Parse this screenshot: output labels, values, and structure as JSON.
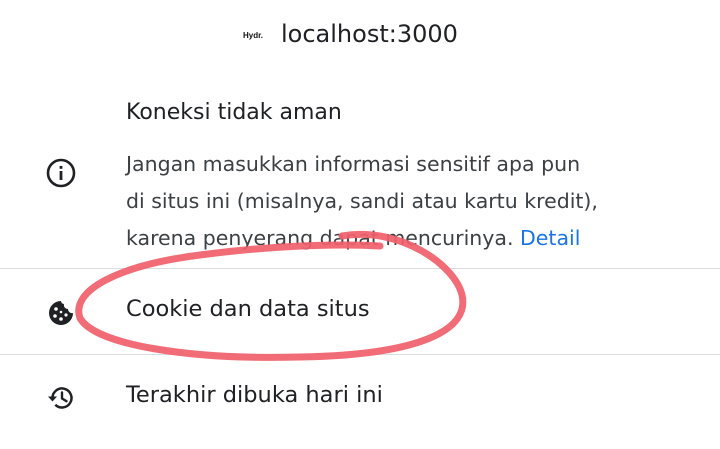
{
  "header": {
    "favicon_text": "Hydr.",
    "host": "localhost:3000"
  },
  "connection": {
    "icon": "info-icon",
    "title": "Koneksi tidak aman",
    "description_lines": [
      "Jangan masukkan informasi sensitif apa pun",
      "di situs ini (misalnya, sandi atau kartu kredit),",
      "karena penyerang dapat mencurinya."
    ],
    "detail_link": "Detail"
  },
  "menu": [
    {
      "icon": "cookie-icon",
      "label": "Cookie dan data situs"
    },
    {
      "icon": "history-icon",
      "label": "Terakhir dibuka hari ini"
    }
  ],
  "colors": {
    "link": "#1a73e8",
    "annotation": "#f0606a",
    "divider": "#dadce0"
  }
}
